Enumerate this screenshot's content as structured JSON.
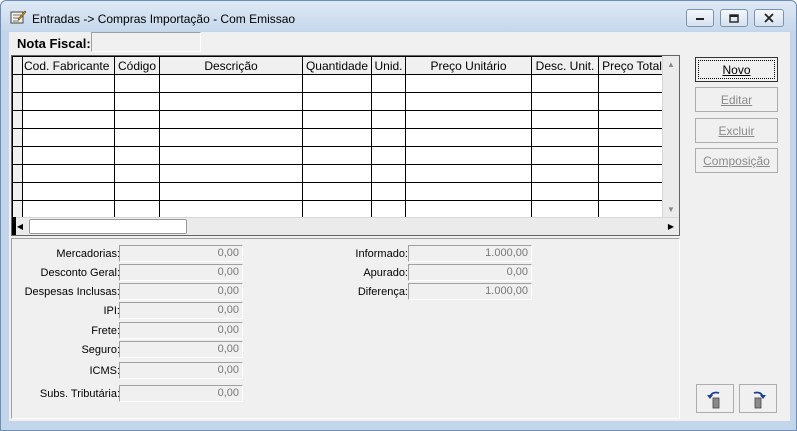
{
  "window": {
    "title": "Entradas -> Compras Importação - Com Emissao"
  },
  "nota_fiscal": {
    "label": "Nota Fiscal:",
    "value": ""
  },
  "grid": {
    "columns": [
      "Cod. Fabricante",
      "Código",
      "Descrição",
      "Quantidade",
      "Unid.",
      "Preço Unitário",
      "Desc. Unit.",
      "Preço Total"
    ]
  },
  "buttons": {
    "novo": "Novo",
    "editar": "Editar",
    "excluir": "Excluir",
    "composicao": "Composição"
  },
  "totals_left": [
    {
      "label": "Mercadorias:",
      "value": "0,00"
    },
    {
      "label": "Desconto Geral:",
      "value": "0,00"
    },
    {
      "label": "Despesas Inclusas:",
      "value": "0,00"
    },
    {
      "label": "IPI:",
      "value": "0,00"
    },
    {
      "label": "Frete:",
      "value": "0,00"
    },
    {
      "label": "Seguro:",
      "value": "0,00"
    },
    {
      "label": "ICMS:",
      "value": "0,00"
    },
    {
      "label": "Subs. Tributária:",
      "value": "0,00"
    }
  ],
  "totals_right": [
    {
      "label": "Informado:",
      "value": "1.000,00"
    },
    {
      "label": "Apurado:",
      "value": "0,00"
    },
    {
      "label": "Diferença:",
      "value": "1.000,00"
    }
  ],
  "icons": {
    "title": "document-edit-icon",
    "undo": "undo-icon",
    "redo": "redo-icon"
  }
}
